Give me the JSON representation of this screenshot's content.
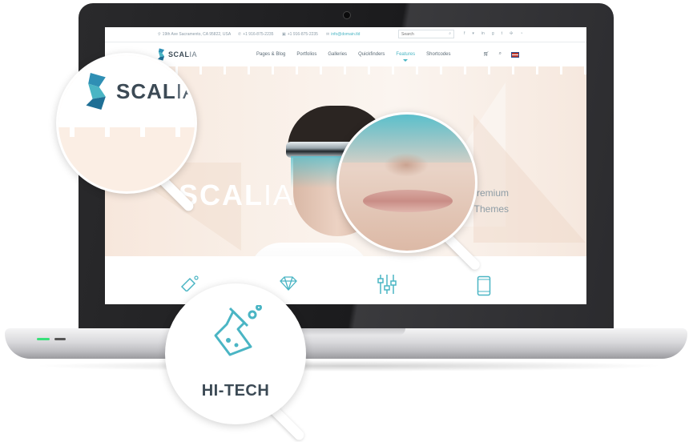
{
  "topbar": {
    "address": "19th Ave Sacramento, CA 95822, USA",
    "phone1": "+1 916-875-2235",
    "phone2": "+1 916-875-2235",
    "email": "info@domain.tld",
    "search_placeholder": "Search"
  },
  "socials": [
    "facebook-icon",
    "twitter-icon",
    "linkedin-icon",
    "googleplus-icon",
    "tumblr-icon",
    "delicious-icon",
    "rss-icon"
  ],
  "logo": {
    "bold": "SCAL",
    "light": "IA"
  },
  "nav": {
    "items": [
      "Pages & Blog",
      "Portfolios",
      "Galleries",
      "Quickfinders",
      "Features",
      "Shortcodes"
    ],
    "active": "Features"
  },
  "hero": {
    "title_bold": "SCAL",
    "title_light": "IA",
    "subtitle_line1": "Premium",
    "subtitle_line2": "Themes"
  },
  "magnifier_logo": {
    "bold": "SCAL",
    "light": "IA"
  },
  "magnifier_hitech": {
    "label": "HI-TECH"
  },
  "colors": {
    "accent": "#4ab5c4",
    "logo_blue": "#2f8fb4",
    "text_dark": "#3c4a55"
  }
}
